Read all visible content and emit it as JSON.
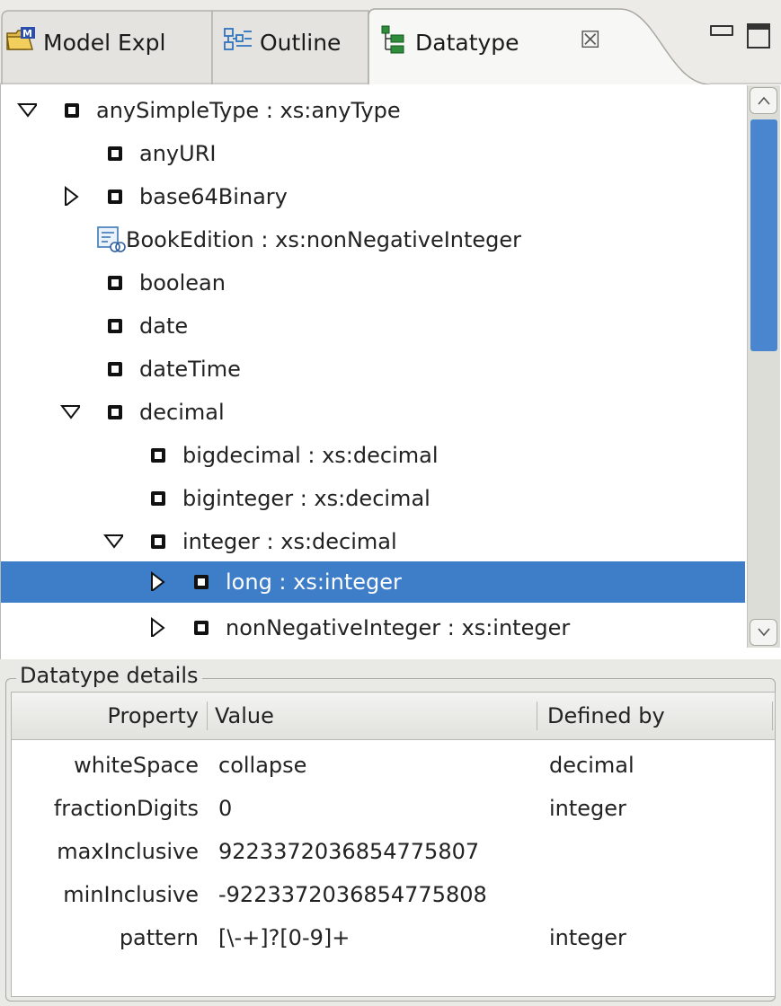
{
  "tabs": [
    {
      "label": "Model Expl",
      "icon": "model-explorer-icon"
    },
    {
      "label": "Outline",
      "icon": "outline-icon"
    },
    {
      "label": "Datatype",
      "icon": "datatype-hierarchy-icon",
      "active": true
    }
  ],
  "tree": {
    "rows": [
      {
        "label": "anySimpleType : xs:anyType",
        "expand": "expanded",
        "icon": "datatype-bullet-icon"
      },
      {
        "label": "anyURI",
        "expand": "none",
        "icon": "datatype-bullet-icon"
      },
      {
        "label": "base64Binary",
        "expand": "collapsed",
        "icon": "datatype-bullet-icon"
      },
      {
        "label": "BookEdition : xs:nonNegativeInteger",
        "expand": "none",
        "icon": "user-datatype-icon"
      },
      {
        "label": "boolean",
        "expand": "none",
        "icon": "datatype-bullet-icon"
      },
      {
        "label": "date",
        "expand": "none",
        "icon": "datatype-bullet-icon"
      },
      {
        "label": "dateTime",
        "expand": "none",
        "icon": "datatype-bullet-icon"
      },
      {
        "label": "decimal",
        "expand": "expanded",
        "icon": "datatype-bullet-icon"
      },
      {
        "label": "bigdecimal : xs:decimal",
        "expand": "none",
        "icon": "datatype-bullet-icon"
      },
      {
        "label": "biginteger : xs:decimal",
        "expand": "none",
        "icon": "datatype-bullet-icon"
      },
      {
        "label": "integer : xs:decimal",
        "expand": "expanded",
        "icon": "datatype-bullet-icon"
      },
      {
        "label": "long : xs:integer",
        "expand": "collapsed",
        "icon": "datatype-bullet-icon",
        "selected": true
      },
      {
        "label": "nonNegativeInteger : xs:integer",
        "expand": "collapsed",
        "icon": "datatype-bullet-icon"
      }
    ]
  },
  "details": {
    "title": "Datatype details",
    "columns": [
      "Property",
      "Value",
      "Defined by"
    ],
    "rows": [
      {
        "property": "whiteSpace",
        "value": "collapse",
        "defined_by": "decimal"
      },
      {
        "property": "fractionDigits",
        "value": "0",
        "defined_by": "integer"
      },
      {
        "property": "maxInclusive",
        "value": "9223372036854775807",
        "defined_by": ""
      },
      {
        "property": "minInclusive",
        "value": "-9223372036854775808",
        "defined_by": ""
      },
      {
        "property": "pattern",
        "value": "[\\-+]?[0-9]+",
        "defined_by": "integer"
      }
    ]
  },
  "colors": {
    "selection": "#3e7ec8",
    "scroll_thumb": "#4a86cf",
    "panel_bg": "#e9e9e6"
  }
}
